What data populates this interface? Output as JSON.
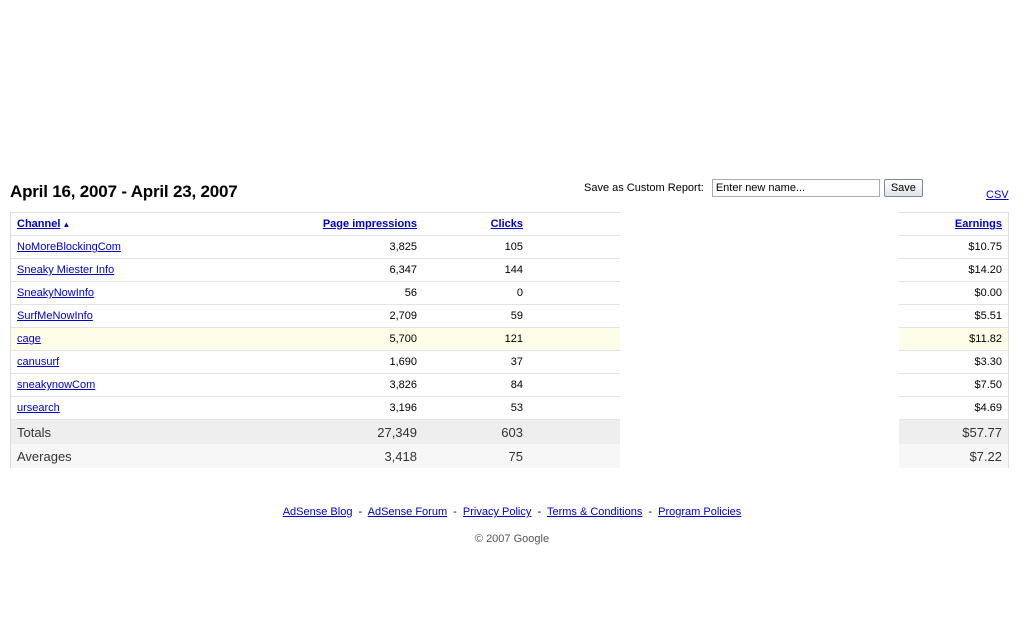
{
  "report": {
    "title": "April 16, 2007 - April 23, 2007"
  },
  "save_custom": {
    "label": "Save as Custom Report:",
    "placeholder": "Enter new name...",
    "button": "Save"
  },
  "csv_label": "CSV",
  "table": {
    "headers": {
      "channel": "Channel",
      "impressions": "Page impressions",
      "clicks": "Clicks",
      "earnings": "Earnings"
    },
    "sort_arrow": "▲",
    "rows": [
      {
        "channel": "NoMoreBlockingCom",
        "impressions": "3,825",
        "clicks": "105",
        "earnings": "$10.75"
      },
      {
        "channel": "Sneaky Miester Info",
        "impressions": "6,347",
        "clicks": "144",
        "earnings": "$14.20"
      },
      {
        "channel": "SneakyNowInfo",
        "impressions": "56",
        "clicks": "0",
        "earnings": "$0.00"
      },
      {
        "channel": "SurfMeNowInfo",
        "impressions": "2,709",
        "clicks": "59",
        "earnings": "$5.51"
      },
      {
        "channel": "cage",
        "impressions": "5,700",
        "clicks": "121",
        "earnings": "$11.82"
      },
      {
        "channel": "canusurf",
        "impressions": "1,690",
        "clicks": "37",
        "earnings": "$3.30"
      },
      {
        "channel": "sneakynowCom",
        "impressions": "3,826",
        "clicks": "84",
        "earnings": "$7.50"
      },
      {
        "channel": "ursearch",
        "impressions": "3,196",
        "clicks": "53",
        "earnings": "$4.69"
      }
    ],
    "totals": {
      "label": "Totals",
      "impressions": "27,349",
      "clicks": "603",
      "earnings": "$57.77"
    },
    "averages": {
      "label": "Averages",
      "impressions": "3,418",
      "clicks": "75",
      "earnings": "$7.22"
    }
  },
  "footer": {
    "links": [
      "AdSense Blog",
      "AdSense Forum",
      "Privacy Policy",
      "Terms & Conditions",
      "Program Policies"
    ],
    "separator": "-",
    "copyright": "© 2007 Google"
  },
  "colors": {
    "link": "#0000cc",
    "highlight_row": "#fdfde8",
    "totals_row": "#eeeeee"
  }
}
